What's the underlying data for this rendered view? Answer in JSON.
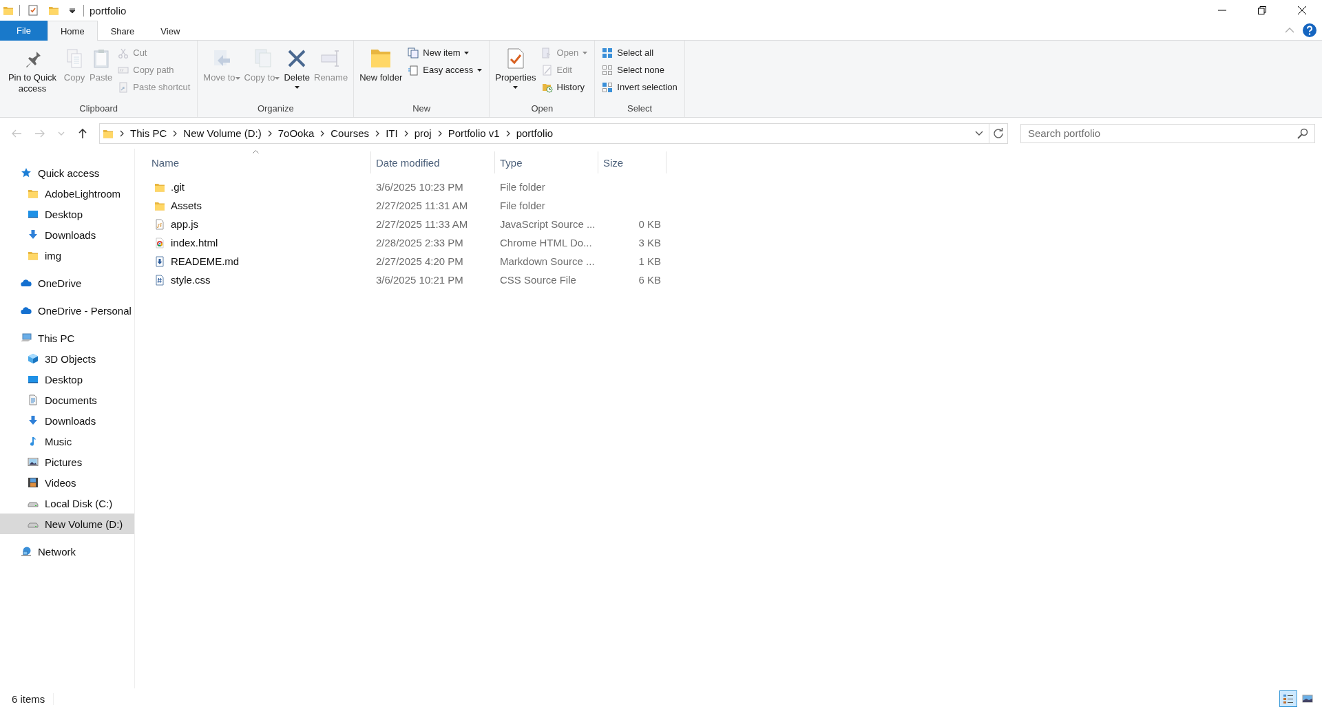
{
  "window": {
    "title": "portfolio"
  },
  "ribbon_tabs": [
    {
      "label": "File",
      "kind": "file",
      "selected": false
    },
    {
      "label": "Home",
      "kind": "tab",
      "selected": true
    },
    {
      "label": "Share",
      "kind": "tab",
      "selected": false
    },
    {
      "label": "View",
      "kind": "tab",
      "selected": false
    }
  ],
  "ribbon_groups": [
    {
      "label": "Clipboard",
      "commands": [
        {
          "label": "Pin to Quick access",
          "kind": "large",
          "disabled": false,
          "dropdown": false
        },
        {
          "label": "Copy",
          "kind": "large",
          "disabled": true,
          "dropdown": false
        },
        {
          "label": "Paste",
          "kind": "large",
          "disabled": true,
          "dropdown": false
        },
        {
          "label": "Cut",
          "kind": "small",
          "disabled": true,
          "dropdown": false
        },
        {
          "label": "Copy path",
          "kind": "small",
          "disabled": true,
          "dropdown": false
        },
        {
          "label": "Paste shortcut",
          "kind": "small",
          "disabled": true,
          "dropdown": false
        }
      ]
    },
    {
      "label": "Organize",
      "commands": [
        {
          "label": "Move to",
          "kind": "large",
          "disabled": true,
          "dropdown": true
        },
        {
          "label": "Copy to",
          "kind": "large",
          "disabled": true,
          "dropdown": true
        },
        {
          "label": "Delete",
          "kind": "large",
          "disabled": false,
          "dropdown": true
        },
        {
          "label": "Rename",
          "kind": "large",
          "disabled": true,
          "dropdown": false
        }
      ]
    },
    {
      "label": "New",
      "commands": [
        {
          "label": "New folder",
          "kind": "large",
          "disabled": false,
          "dropdown": false
        },
        {
          "label": "New item",
          "kind": "small",
          "disabled": false,
          "dropdown": true
        },
        {
          "label": "Easy access",
          "kind": "small",
          "disabled": false,
          "dropdown": true
        }
      ]
    },
    {
      "label": "Open",
      "commands": [
        {
          "label": "Properties",
          "kind": "large",
          "disabled": false,
          "dropdown": true
        },
        {
          "label": "Open",
          "kind": "small",
          "disabled": true,
          "dropdown": true
        },
        {
          "label": "Edit",
          "kind": "small",
          "disabled": true,
          "dropdown": false
        },
        {
          "label": "History",
          "kind": "small",
          "disabled": false,
          "dropdown": false
        }
      ]
    },
    {
      "label": "Select",
      "commands": [
        {
          "label": "Select all",
          "kind": "small",
          "disabled": false,
          "dropdown": false
        },
        {
          "label": "Select none",
          "kind": "small",
          "disabled": false,
          "dropdown": false
        },
        {
          "label": "Invert selection",
          "kind": "small",
          "disabled": false,
          "dropdown": false
        }
      ]
    }
  ],
  "nav_buttons": [
    {
      "kind": "back",
      "disabled": true
    },
    {
      "kind": "forward",
      "disabled": true
    },
    {
      "kind": "recent",
      "disabled": true
    },
    {
      "kind": "up",
      "disabled": false
    }
  ],
  "breadcrumbs": [
    "This PC",
    "New Volume (D:)",
    "7oOoka",
    "Courses",
    "ITI",
    "proj",
    "Portfolio v1",
    "portfolio"
  ],
  "search": {
    "placeholder": "Search portfolio"
  },
  "navigation": [
    {
      "label": "Quick access",
      "kind": "star",
      "selected": false,
      "children": [
        {
          "label": "AdobeLightroom",
          "kind": "folder",
          "selected": false
        },
        {
          "label": "Desktop",
          "kind": "desktop",
          "selected": false
        },
        {
          "label": "Downloads",
          "kind": "downloads",
          "selected": false
        },
        {
          "label": "img",
          "kind": "folder",
          "selected": false
        }
      ]
    },
    {
      "label": "OneDrive",
      "kind": "cloud",
      "selected": false
    },
    {
      "label": "OneDrive - Personal",
      "kind": "cloud",
      "selected": false
    },
    {
      "label": "This PC",
      "kind": "pc",
      "selected": false,
      "children": [
        {
          "label": "3D Objects",
          "kind": "cube",
          "selected": false
        },
        {
          "label": "Desktop",
          "kind": "desktop",
          "selected": false
        },
        {
          "label": "Documents",
          "kind": "documents",
          "selected": false
        },
        {
          "label": "Downloads",
          "kind": "downloads",
          "selected": false
        },
        {
          "label": "Music",
          "kind": "music",
          "selected": false
        },
        {
          "label": "Pictures",
          "kind": "pictures",
          "selected": false
        },
        {
          "label": "Videos",
          "kind": "videos",
          "selected": false
        },
        {
          "label": "Local Disk (C:)",
          "kind": "disk",
          "selected": false
        },
        {
          "label": "New Volume (D:)",
          "kind": "disk",
          "selected": true
        }
      ]
    },
    {
      "label": "Network",
      "kind": "network",
      "selected": false
    }
  ],
  "file_list": {
    "columns": [
      {
        "label": "Name",
        "sorted": true
      },
      {
        "label": "Date modified",
        "sorted": false
      },
      {
        "label": "Type",
        "sorted": false
      },
      {
        "label": "Size",
        "sorted": false
      }
    ],
    "rows": [
      {
        "name": ".git",
        "date": "3/6/2025 10:23 PM",
        "type": "File folder",
        "kind": "folder"
      },
      {
        "name": "Assets",
        "date": "2/27/2025 11:31 AM",
        "type": "File folder",
        "kind": "folder"
      },
      {
        "name": "app.js",
        "date": "2/27/2025 11:33 AM",
        "type": "JavaScript Source ...",
        "size": "0 KB",
        "kind": "js"
      },
      {
        "name": "index.html",
        "date": "2/28/2025 2:33 PM",
        "type": "Chrome HTML Do...",
        "size": "3 KB",
        "kind": "html"
      },
      {
        "name": "READEME.md",
        "date": "2/27/2025 4:20 PM",
        "type": "Markdown Source ...",
        "size": "1 KB",
        "kind": "md"
      },
      {
        "name": "style.css",
        "date": "3/6/2025 10:21 PM",
        "type": "CSS Source File",
        "size": "6 KB",
        "kind": "css"
      }
    ]
  },
  "status_bar": {
    "item_count": "6 items",
    "views": [
      {
        "kind": "details",
        "selected": true
      },
      {
        "kind": "large-icons",
        "selected": false
      }
    ]
  }
}
